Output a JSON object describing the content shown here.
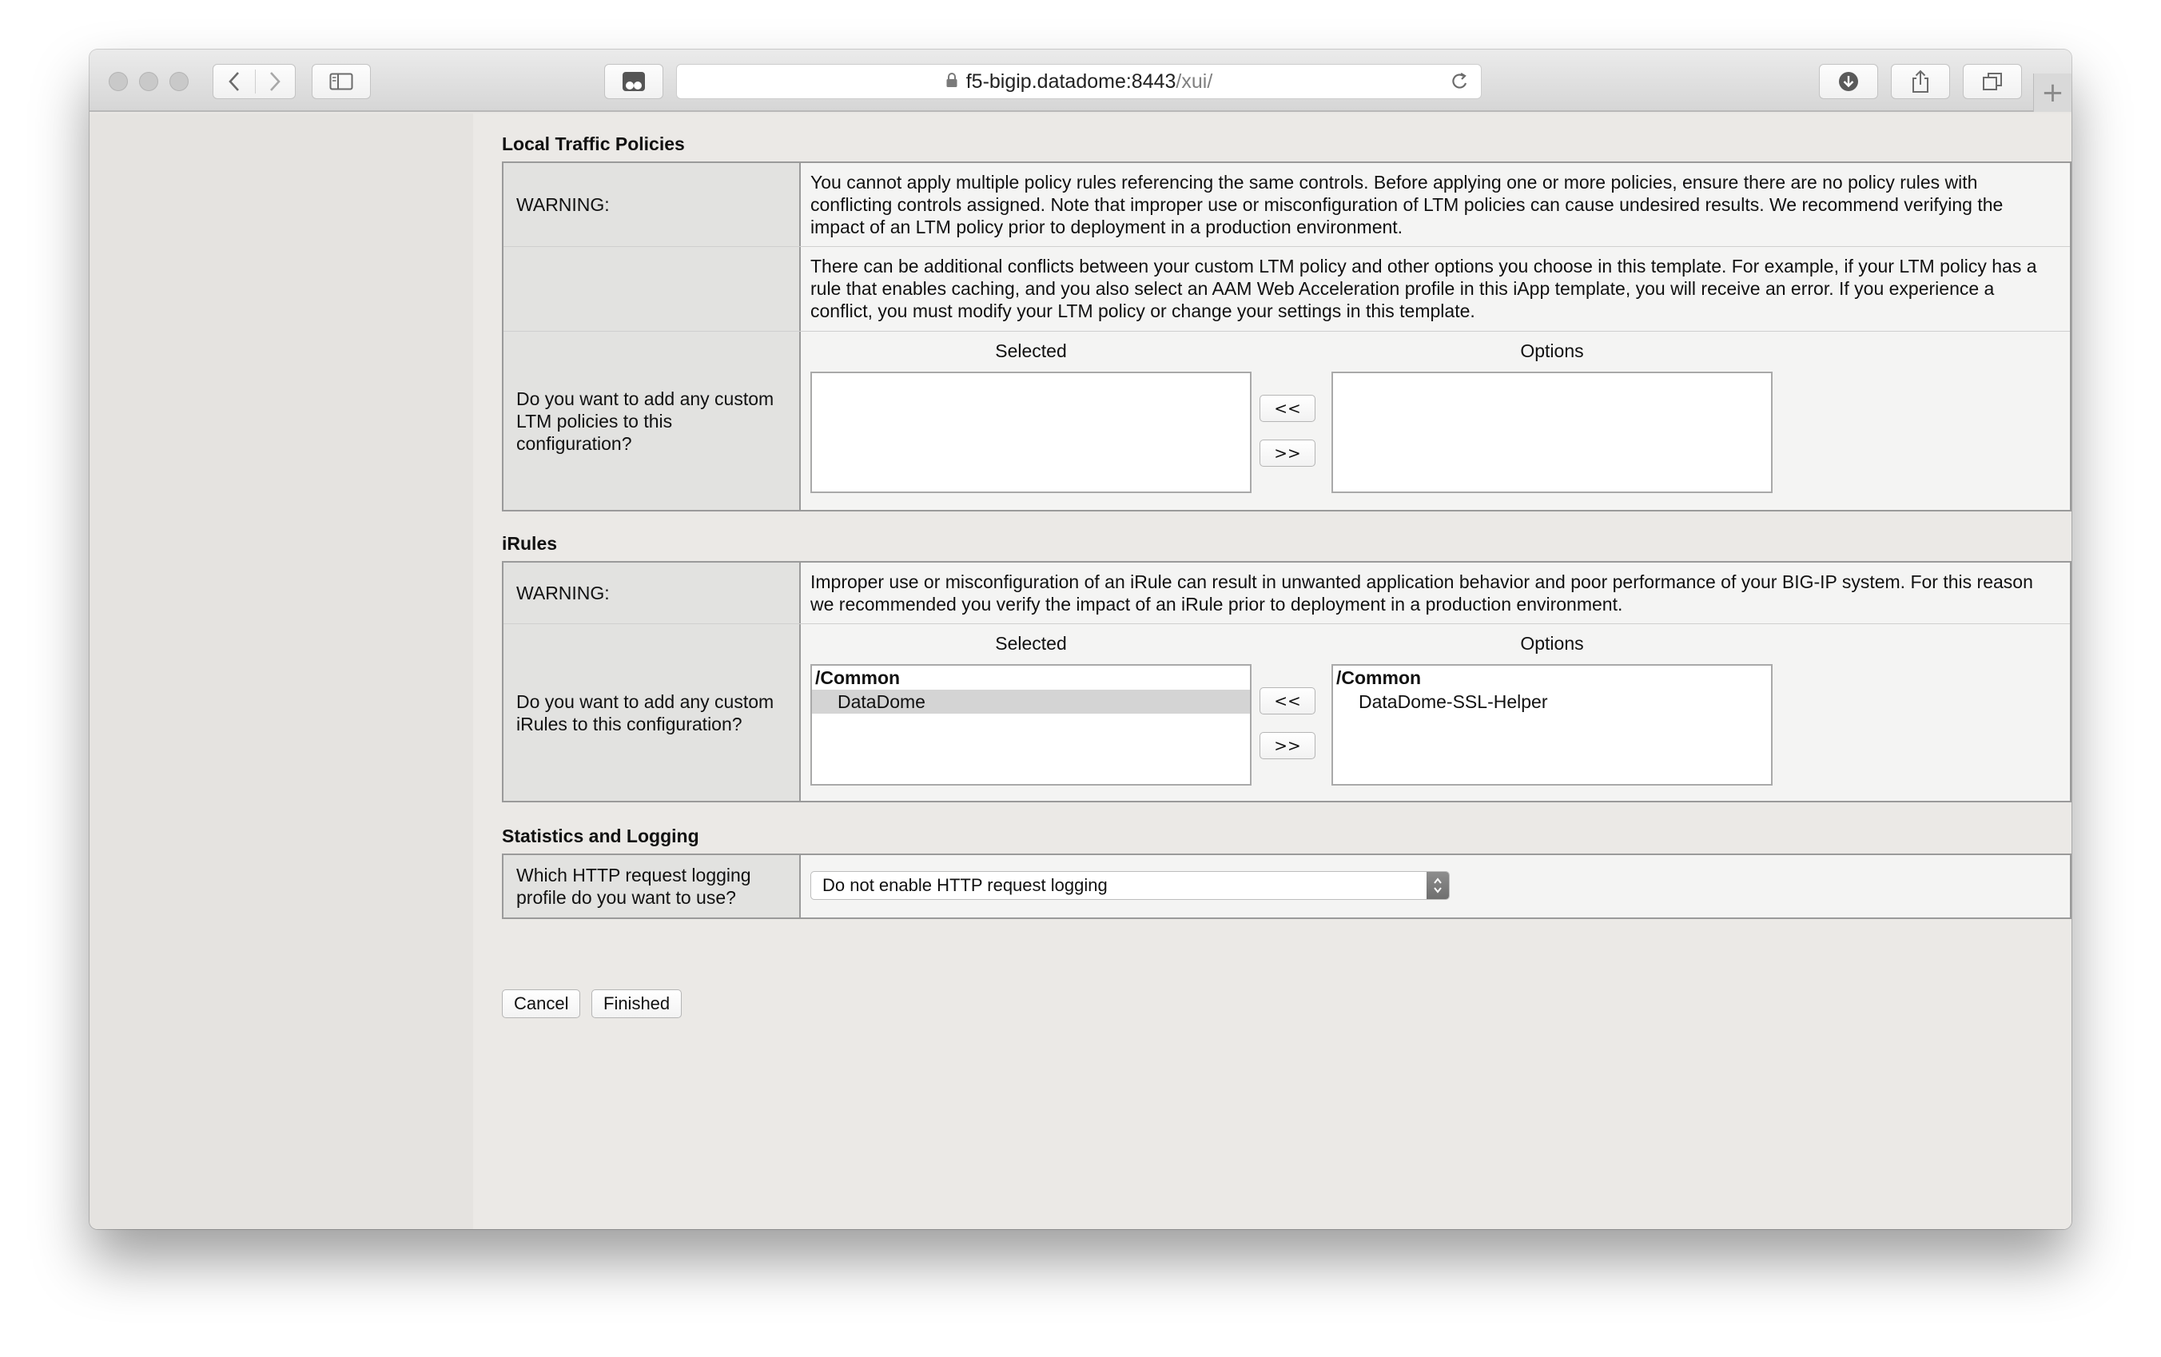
{
  "browser": {
    "url_host": "f5-bigip.datadome:8443",
    "url_path": "/xui/",
    "new_tab_symbol": "+"
  },
  "ltm": {
    "title": "Local Traffic Policies",
    "warning_label": "WARNING:",
    "warning_text": "You cannot apply multiple policy rules referencing the same controls. Before applying one or more policies, ensure there are no policy rules with conflicting controls assigned. Note that improper use or misconfiguration of LTM policies can cause undesired results. We recommend verifying the impact of an LTM policy prior to deployment in a production environment.",
    "conflict_text": "There can be additional conflicts between your custom LTM policy and other options you choose in this template. For example, if your LTM policy has a rule that enables caching, and you also select an AAM Web Acceleration profile in this iApp template, you will receive an error. If you experience a conflict, you must modify your LTM policy or change your settings in this template.",
    "question": "Do you want to add any custom LTM policies to this configuration?",
    "selected_header": "Selected",
    "options_header": "Options",
    "add_label": "<<",
    "remove_label": ">>"
  },
  "irules": {
    "title": "iRules",
    "warning_label": "WARNING:",
    "warning_text": "Improper use or misconfiguration of an iRule can result in unwanted application behavior and poor performance of your BIG-IP system. For this reason we recommended you verify the impact of an iRule prior to deployment in a production environment.",
    "question": "Do you want to add any custom iRules to this configuration?",
    "selected_header": "Selected",
    "options_header": "Options",
    "selected_group": "/Common",
    "selected_items": [
      "DataDome"
    ],
    "options_group": "/Common",
    "options_items": [
      "DataDome-SSL-Helper"
    ],
    "add_label": "<<",
    "remove_label": ">>"
  },
  "stats": {
    "title": "Statistics and Logging",
    "question": "Which HTTP request logging profile do you want to use?",
    "select_value": "Do not enable HTTP request logging"
  },
  "buttons": {
    "cancel": "Cancel",
    "finished": "Finished"
  }
}
